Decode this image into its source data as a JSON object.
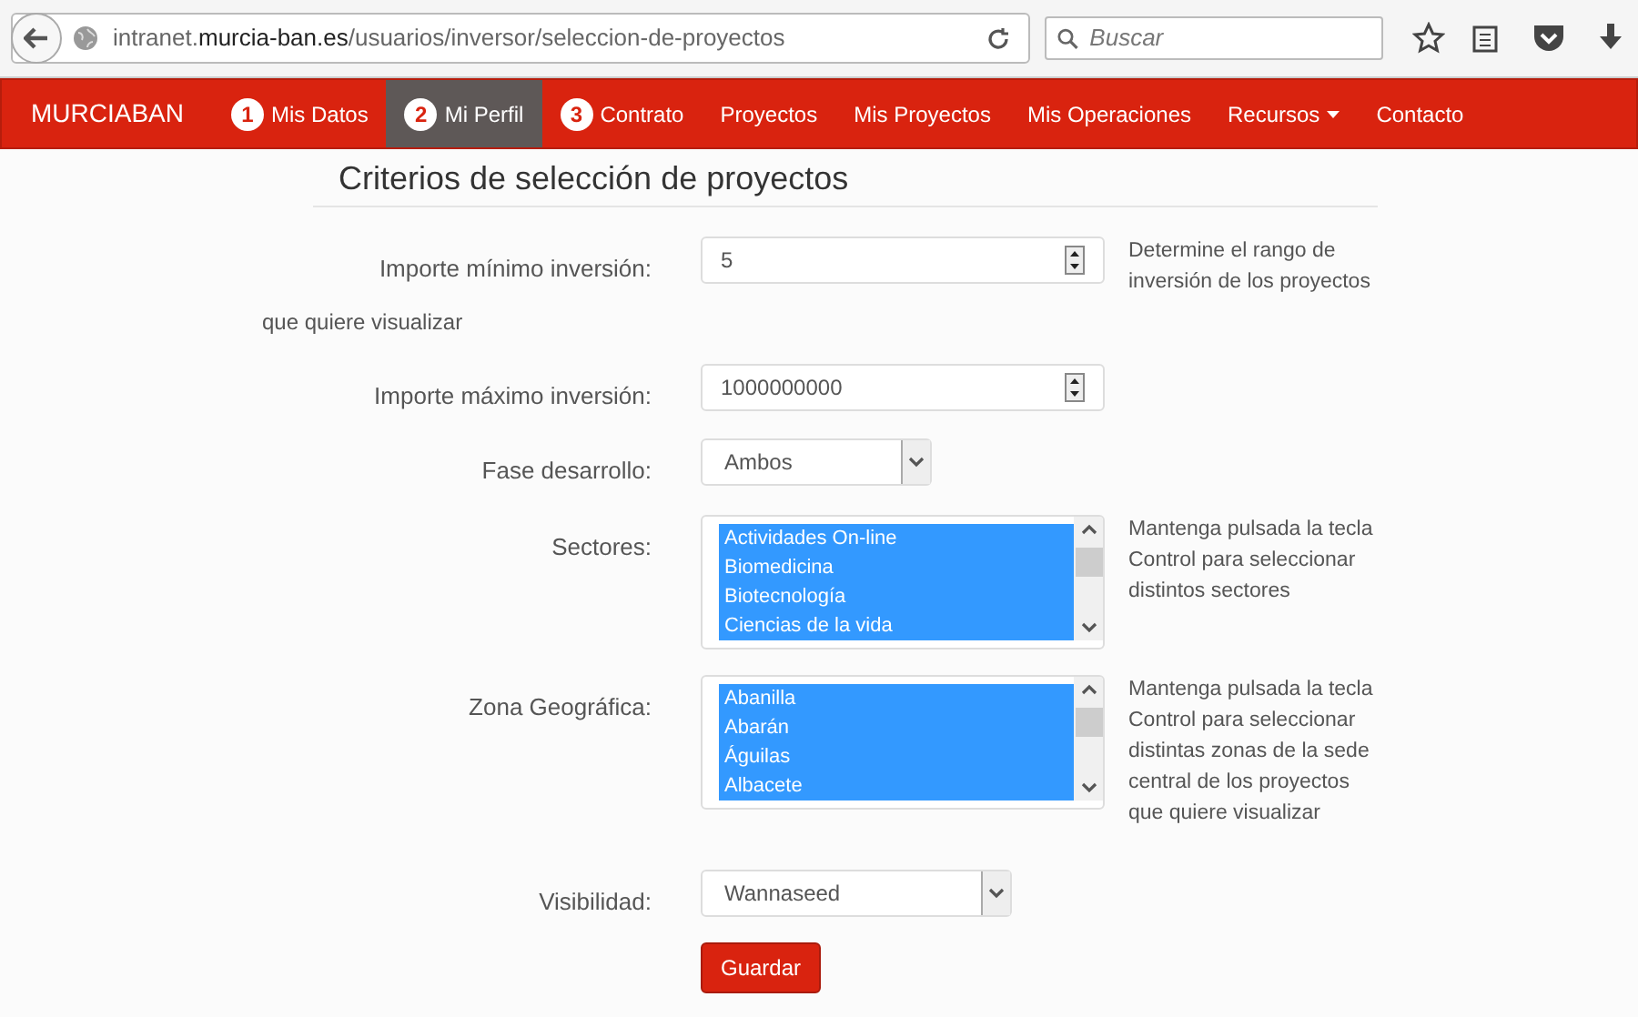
{
  "browser": {
    "url": "intranet.**murcia-ban.es**/usuarios/inversor/seleccion-de-proyectos",
    "search_placeholder": "Buscar"
  },
  "nav": {
    "brand": "MURCIABAN",
    "items": [
      {
        "badge": "1",
        "label": "Mis Datos",
        "selected": false,
        "dropdown": false
      },
      {
        "badge": "2",
        "label": "Mi Perfil",
        "selected": true,
        "dropdown": false
      },
      {
        "badge": "3",
        "label": "Contrato",
        "selected": false,
        "dropdown": false
      },
      {
        "label": "Proyectos",
        "selected": false,
        "dropdown": false
      },
      {
        "label": "Mis Proyectos",
        "selected": false,
        "dropdown": false
      },
      {
        "label": "Mis Operaciones",
        "selected": false,
        "dropdown": false
      },
      {
        "label": "Recursos",
        "selected": false,
        "dropdown": true
      },
      {
        "label": "Contacto",
        "selected": false,
        "dropdown": false
      }
    ]
  },
  "form": {
    "title": "Criterios de selección de proyectos",
    "fields": [
      {
        "kind": "number",
        "label": "Importe mínimo inversión:",
        "note": "que quiere visualizar",
        "value": "5",
        "help": "Determine el rango de inversión de los proyectos"
      },
      {
        "kind": "number",
        "label": "Importe máximo inversión:",
        "value": "1000000000"
      },
      {
        "kind": "select",
        "label": "Fase desarrollo:",
        "value": "Ambos"
      },
      {
        "kind": "multiselect",
        "label": "Sectores:",
        "options": [
          {
            "label": "Actividades On-line",
            "selected": true
          },
          {
            "label": "Biomedicina",
            "selected": true
          },
          {
            "label": "Biotecnología",
            "selected": true
          },
          {
            "label": "Ciencias de la vida",
            "selected": true
          }
        ],
        "help": "Mantenga pulsada la tecla Control para seleccionar distintos sectores"
      },
      {
        "kind": "multiselect",
        "label": "Zona Geográfica:",
        "options": [
          {
            "label": "Abanilla",
            "selected": true
          },
          {
            "label": "Abarán",
            "selected": true
          },
          {
            "label": "Águilas",
            "selected": true
          },
          {
            "label": "Albacete",
            "selected": true
          }
        ],
        "help": "Mantenga pulsada la tecla Control para seleccionar distintas zonas de la sede central de los proyectos que quiere visualizar"
      },
      {
        "kind": "select",
        "label": "Visibilidad:",
        "value": "Wannaseed"
      }
    ],
    "submit": "Guardar"
  }
}
